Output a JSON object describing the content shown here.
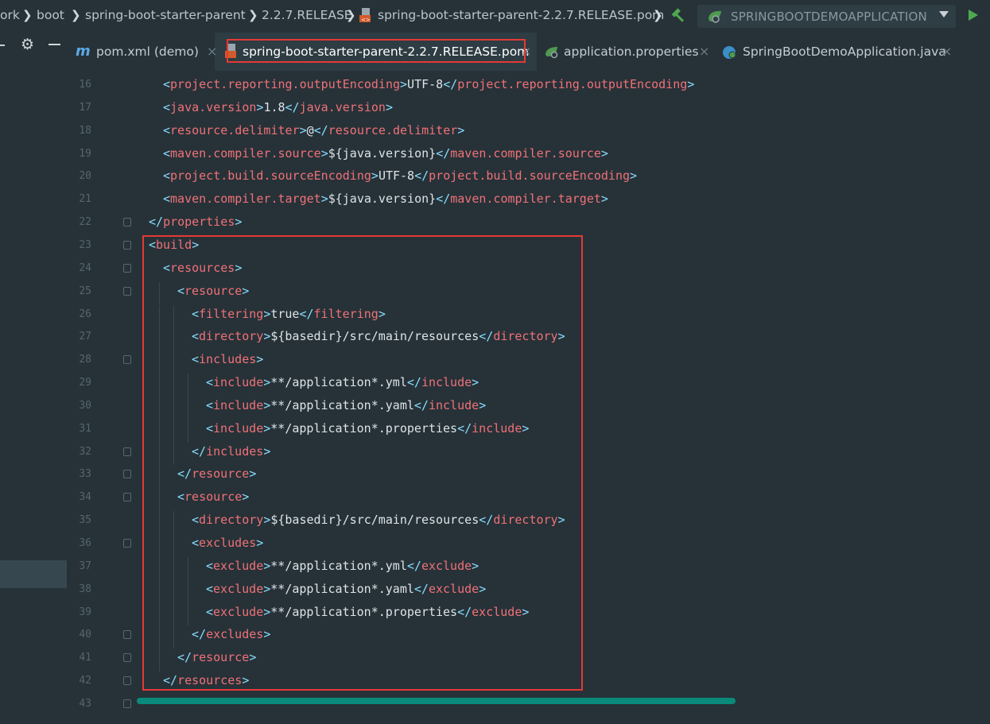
{
  "breadcrumb": {
    "items": [
      "ork",
      "boot",
      "spring-boot-starter-parent",
      "2.2.7.RELEASE",
      "spring-boot-starter-parent-2.2.7.RELEASE.pom"
    ],
    "separator": "❯"
  },
  "run_config": {
    "label": "SPRINGBOOTDEMOAPPLICATION"
  },
  "tabs": [
    {
      "label": "pom.xml (demo)",
      "close": "×",
      "icon": "maven-m-icon"
    },
    {
      "label": "spring-boot-starter-parent-2.2.7.RELEASE.pom",
      "close": "×",
      "icon": "pom-file-icon",
      "active": true
    },
    {
      "label": "application.properties",
      "close": "×",
      "icon": "spring-properties-icon"
    },
    {
      "label": "SpringBootDemoApplication.java",
      "close": "×",
      "icon": "spring-class-icon"
    }
  ],
  "editor": {
    "lines": [
      {
        "n": "16",
        "indent": 1,
        "open": "project.reporting.outputEncoding",
        "text": "UTF-8",
        "close": "project.reporting.outputEncoding"
      },
      {
        "n": "17",
        "indent": 1,
        "open": "java.version",
        "text": "1.8",
        "close": "java.version"
      },
      {
        "n": "18",
        "indent": 1,
        "open": "resource.delimiter",
        "text": "@",
        "close": "resource.delimiter"
      },
      {
        "n": "19",
        "indent": 1,
        "open": "maven.compiler.source",
        "text": "${java.version}",
        "close": "maven.compiler.source"
      },
      {
        "n": "20",
        "indent": 1,
        "open": "project.build.sourceEncoding",
        "text": "UTF-8",
        "close": "project.build.sourceEncoding"
      },
      {
        "n": "21",
        "indent": 1,
        "open": "maven.compiler.target",
        "text": "${java.version}",
        "close": "maven.compiler.target"
      },
      {
        "n": "22",
        "indent": 0,
        "close": "properties",
        "fold": true
      },
      {
        "n": "23",
        "indent": 0,
        "open": "build",
        "fold": true
      },
      {
        "n": "24",
        "indent": 1,
        "open": "resources",
        "fold": true
      },
      {
        "n": "25",
        "indent": 2,
        "open": "resource",
        "fold": true
      },
      {
        "n": "26",
        "indent": 3,
        "open": "filtering",
        "text": "true",
        "close": "filtering"
      },
      {
        "n": "27",
        "indent": 3,
        "open": "directory",
        "text": "${basedir}/src/main/resources",
        "close": "directory"
      },
      {
        "n": "28",
        "indent": 3,
        "open": "includes",
        "fold": true
      },
      {
        "n": "29",
        "indent": 4,
        "open": "include",
        "text": "**/application*.yml",
        "close": "include"
      },
      {
        "n": "30",
        "indent": 4,
        "open": "include",
        "text": "**/application*.yaml",
        "close": "include"
      },
      {
        "n": "31",
        "indent": 4,
        "open": "include",
        "text": "**/application*.properties",
        "close": "include"
      },
      {
        "n": "32",
        "indent": 3,
        "close": "includes",
        "fold": true
      },
      {
        "n": "33",
        "indent": 2,
        "close": "resource",
        "fold": true
      },
      {
        "n": "34",
        "indent": 2,
        "open": "resource",
        "fold": true
      },
      {
        "n": "35",
        "indent": 3,
        "open": "directory",
        "text": "${basedir}/src/main/resources",
        "close": "directory"
      },
      {
        "n": "36",
        "indent": 3,
        "open": "excludes",
        "fold": true
      },
      {
        "n": "37",
        "indent": 4,
        "open": "exclude",
        "text": "**/application*.yml",
        "close": "exclude"
      },
      {
        "n": "38",
        "indent": 4,
        "open": "exclude",
        "text": "**/application*.yaml",
        "close": "exclude"
      },
      {
        "n": "39",
        "indent": 4,
        "open": "exclude",
        "text": "**/application*.properties",
        "close": "exclude"
      },
      {
        "n": "40",
        "indent": 3,
        "close": "excludes",
        "fold": true
      },
      {
        "n": "41",
        "indent": 2,
        "close": "resource",
        "fold": true
      },
      {
        "n": "42",
        "indent": 1,
        "close": "resources",
        "fold": true
      },
      {
        "n": "43",
        "indent": 1,
        "fold": true
      }
    ]
  },
  "colors": {
    "background": "#263238",
    "tag": "#f07178",
    "punctuation": "#89ddff",
    "highlight_box": "#e53935",
    "scrollbar": "#0a8a7a"
  }
}
